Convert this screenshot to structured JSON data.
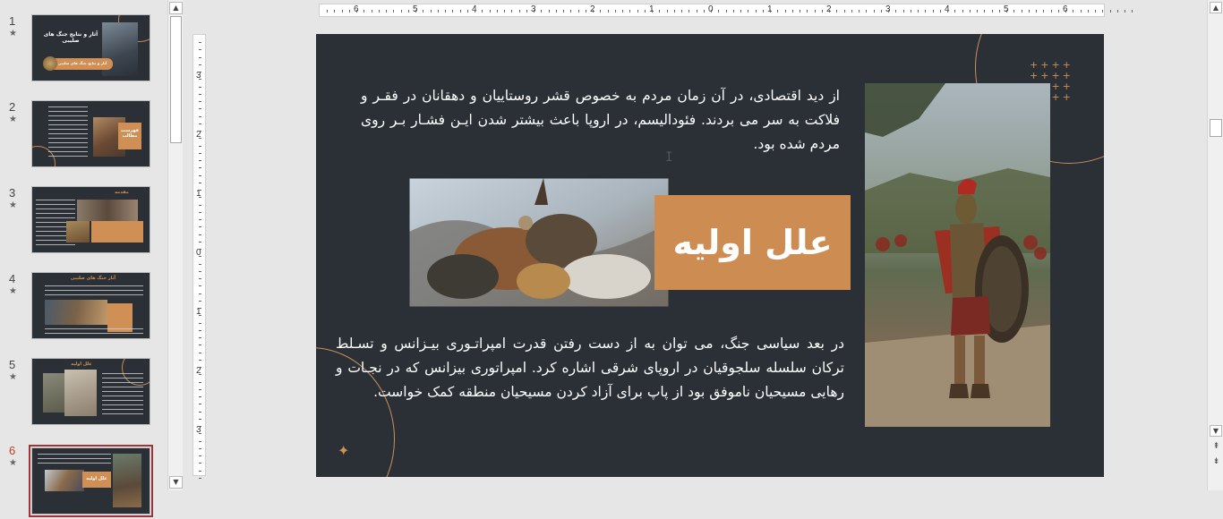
{
  "thumbnails": [
    {
      "num": "1",
      "title": "آثار و نتایج جنگ های صلیبی",
      "subtitle": "آثار و نتایج جنگ های صلیبی"
    },
    {
      "num": "2",
      "title": "فهرست مطالب",
      "items": [
        "مقدمه",
        "آثار جنگ های صلیبی",
        "علل اولیه",
        "سیاسی جنگ های صلیبی",
        "سیاسی جنگ های صلیبی",
        "فرهنگی جنگ های صلیبی",
        "مذهبی جنگ های صلیبی",
        "اقتصادی جنگ های صلیبی",
        "دینی جنگ های صلیبی",
        "آثار و نتایج جنگ های صلیبی"
      ]
    },
    {
      "num": "3",
      "title": "مقدمه"
    },
    {
      "num": "4",
      "title": "آثار جنگ های صلیبی"
    },
    {
      "num": "5",
      "title": "علل اولیه"
    },
    {
      "num": "6",
      "title": "علل اولیه"
    }
  ],
  "star": "★",
  "ruler": {
    "h_labels": [
      "6",
      "5",
      "4",
      "3",
      "2",
      "1",
      "0",
      "1",
      "2",
      "3",
      "4",
      "5",
      "6"
    ],
    "v_labels": [
      "3",
      "2",
      "1",
      "0",
      "1",
      "2",
      "3"
    ]
  },
  "slide": {
    "title": "علل اولیه",
    "paragraph1": "از دید اقتصادی، در آن زمان مردم به خصوص قشر روستاییان و دهقانان در فقـر و فلاکت به سر می بردند. فئودالیسم، در اروپا باعث بیشتر شدن ایـن فشـار بـر روی مردم شده بود.",
    "paragraph2": "در بعد سیاسی جنگ، می توان به از دست رفتن قدرت امپراتـوری بیـزانس و تسـلط ترکان سلسله سلجوقیان در اروپای شرقی اشاره کرد. امپراتوری بیزانس که در نجـات و رهایی مسیحیان ناموفق بود از پاپ برای آزاد کردن مسیحیان منطقه کمک خواست.",
    "accent_color": "#cd8d52",
    "background_color": "#2b2f36"
  },
  "scroll": {
    "up": "▲",
    "down": "▼",
    "prev_slide": "⇞",
    "next_slide": "⇟"
  },
  "icons": {
    "cursor": "I",
    "plus": "+",
    "sparkle": "✦"
  }
}
